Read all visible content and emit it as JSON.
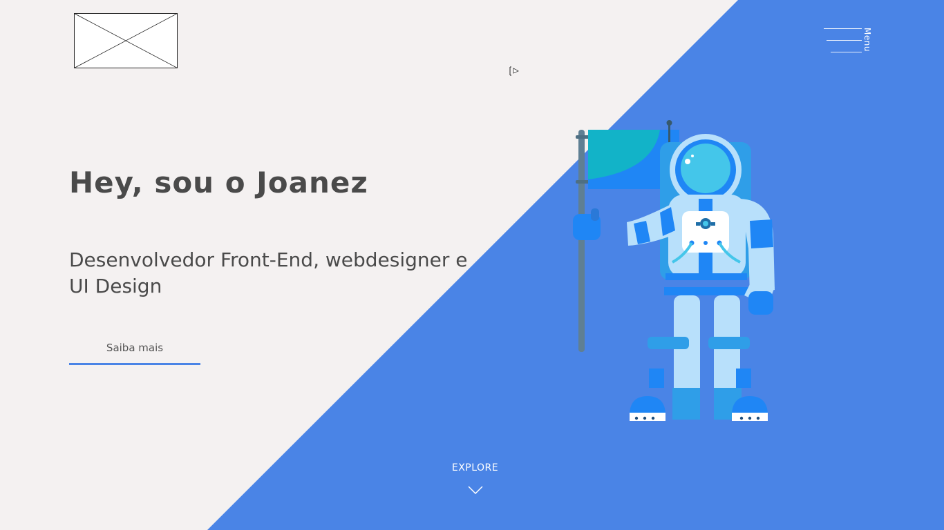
{
  "header": {
    "logo_alt": "logo placeholder",
    "menu_label": "Menu"
  },
  "hero": {
    "title": "Hey, sou o Joanez",
    "subtitle": "Desenvolvedor Front-End, webdesigner e UI Design",
    "cta_label": "Saiba mais"
  },
  "explore": {
    "label": "EXPLORE"
  },
  "illustration": {
    "icon": "astronaut-with-flag"
  },
  "colors": {
    "background": "#f4f1f1",
    "accent_blue": "#4a84e6",
    "text": "#4a4a4a"
  }
}
